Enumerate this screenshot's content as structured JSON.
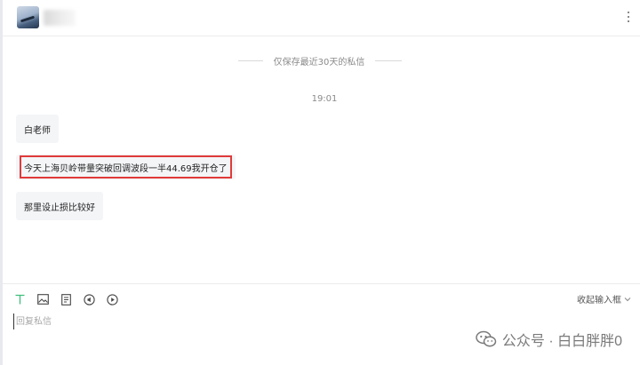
{
  "notice": "仅保存最近30天的私信",
  "timestamp": "19:01",
  "messages": [
    {
      "text": "白老师"
    },
    {
      "text": "今天上海贝岭带量突破回调波段一半44.69我开仓了"
    },
    {
      "text": "那里设止损比较好"
    }
  ],
  "compose": {
    "collapse_label": "收起输入框",
    "placeholder": "回复私信"
  },
  "watermark": "公众号 · 白白胖胖0",
  "colors": {
    "highlight_border": "#e03a3a",
    "bubble_bg": "#f4f5f7",
    "tool_accent": "#3cbf7b"
  },
  "icons": [
    "text-format-icon",
    "image-icon",
    "document-icon",
    "audio-icon",
    "video-icon",
    "chevron-down-icon",
    "wechat-icon"
  ]
}
